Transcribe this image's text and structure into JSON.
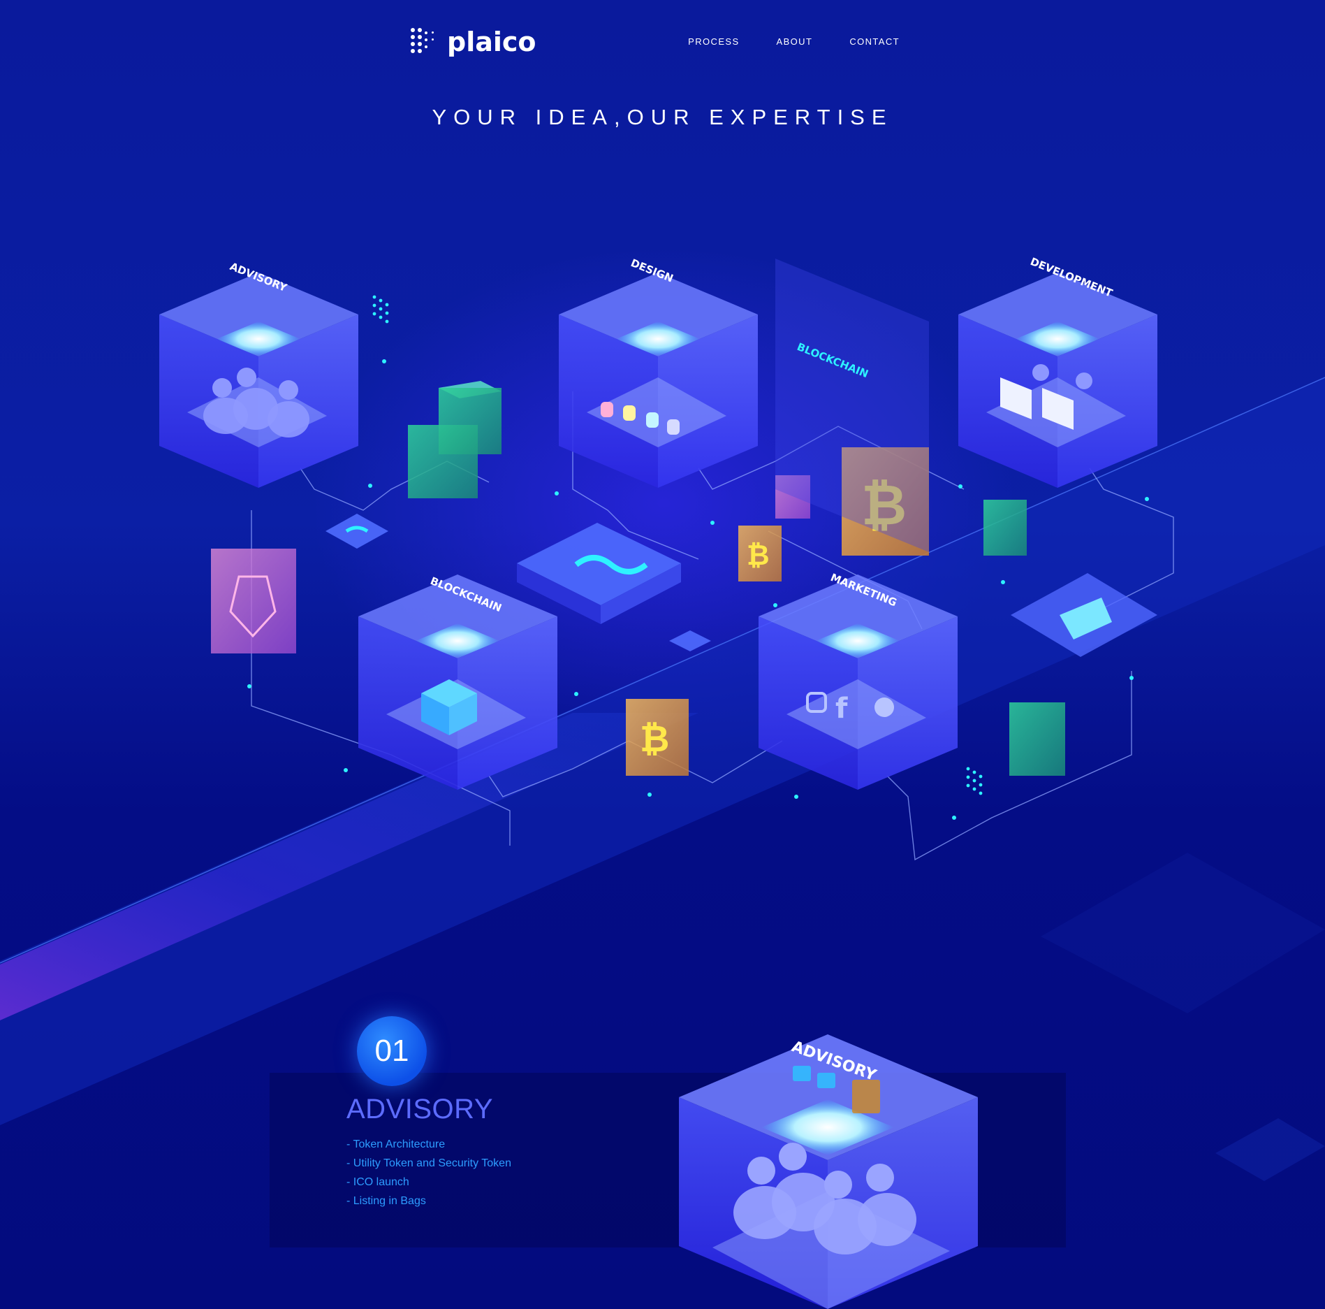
{
  "brand": {
    "name": "plaico"
  },
  "nav": {
    "items": [
      "PROCESS",
      "ABOUT",
      "CONTACT"
    ]
  },
  "hero": {
    "title": "YOUR IDEA,OUR EXPERTISE"
  },
  "illustration": {
    "cubes": [
      "ADVISORY",
      "DESIGN",
      "DEVELOPMENT",
      "BLOCKCHAIN",
      "MARKETING"
    ],
    "panel_label": "BLOCKCHAIN",
    "colors": {
      "accent_cyan": "#2ef2ff",
      "glow": "#6f7cff",
      "gold": "#f0c53a",
      "green": "#32e08a",
      "pink": "#e68ad0"
    }
  },
  "section": {
    "number": "01",
    "title": "ADVISORY",
    "items": [
      "- Token Architecture",
      "- Utility Token and Security Token",
      "- ICO launch",
      "- Listing in Bags"
    ],
    "cube_label": "ADVISORY"
  }
}
